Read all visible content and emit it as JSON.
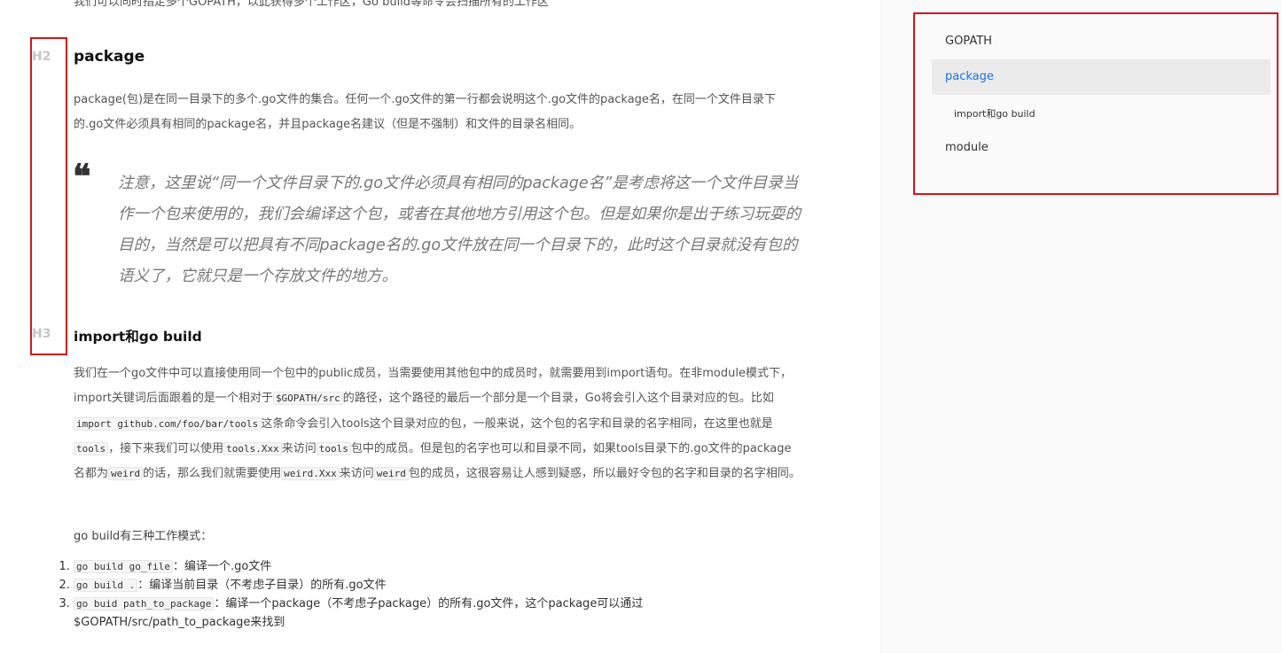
{
  "article": {
    "top_text": "我们可以同时指定多个GOPATH，以此获得多个工作区，Go build等命令会扫描所有的工作区",
    "h2_marker": "H2",
    "h3_marker": "H3",
    "h2_title": "package",
    "package_para": "package(包)是在同一目录下的多个.go文件的集合。任何一个.go文件的第一行都会说明这个.go文件的package名，在同一个文件目录下的.go文件必须具有相同的package名，并且package名建议（但是不强制）和文件的目录名相同。",
    "quote_mark": "❝",
    "quote": "注意，这里说“同一个文件目录下的.go文件必须具有相同的package名”是考虑将这一个文件目录当作一个包来使用的，我们会编译这个包，或者在其他地方引用这个包。但是如果你是出于练习玩耍的目的，当然是可以把具有不同package名的.go文件放在同一个目录下的，此时这个目录就没有包的语义了，它就只是一个存放文件的地方。",
    "h3_title": "import和go build",
    "import_para": {
      "t1": "我们在一个go文件中可以直接使用同一个包中的public成员，当需要使用其他包中的成员时，就需要用到import语句。在非module模式下，import关键词后面跟着的是一个相对于",
      "c1": "$GOPATH/src",
      "t2": "的路径，这个路径的最后一个部分是一个目录，Go将会引入这个目录对应的包。比如",
      "c2": "import github.com/foo/bar/tools",
      "t3": "这条命令会引入tools这个目录对应的包，一般来说，这个包的名字和目录的名字相同，在这里也就是",
      "c3": "tools",
      "t4": "，接下来我们可以使用",
      "c4": "tools.Xxx",
      "t5": "来访问",
      "c5": "tools",
      "t6": "包中的成员。但是包的名字也可以和目录不同，如果tools目录下的.go文件的package名都为",
      "c6": "weird",
      "t7": "的话，那么我们就需要使用",
      "c7": "weird.Xxx",
      "t8": "来访问",
      "c8": "weird",
      "t9": "包的成员，这很容易让人感到疑惑，所以最好令包的名字和目录的名字相同。"
    },
    "modes_title": "go build有三种工作模式：",
    "modes": [
      {
        "code": "go build go_file",
        "text": "：编译一个.go文件"
      },
      {
        "code": "go build .",
        "text": "：编译当前目录（不考虑子目录）的所有.go文件"
      },
      {
        "code": "go buid path_to_package",
        "text": "：编译一个package（不考虑子package）的所有.go文件，这个package可以通过$GOPATH/src/path_to_package来找到"
      }
    ]
  },
  "toc": {
    "items": [
      {
        "label": "GOPATH"
      },
      {
        "label": "package"
      },
      {
        "label": "import和go build"
      },
      {
        "label": "module"
      }
    ]
  },
  "colors": {
    "highlight_border": "#d0161b",
    "toc_active": "#1a73e8"
  }
}
